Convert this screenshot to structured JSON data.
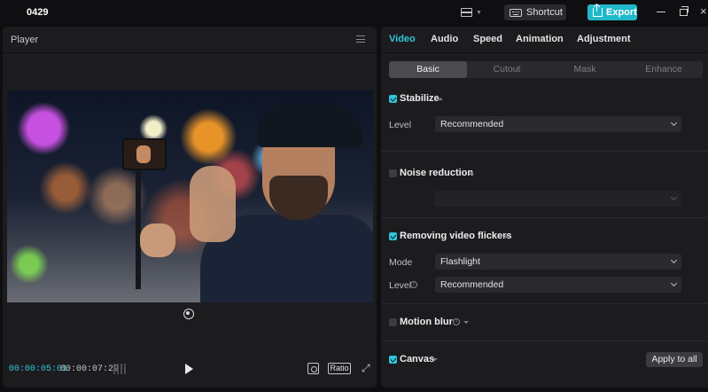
{
  "app": {
    "project_title": "0429"
  },
  "topbar": {
    "layout_icon": "layout-icon",
    "shortcut_label": "Shortcut",
    "export_label": "Export",
    "accent_color": "#21b8c9"
  },
  "player": {
    "title": "Player",
    "current_time": "00:00:05:01",
    "total_time": "00:00:07:29",
    "ratio_label": "Ratio"
  },
  "inspector": {
    "tabs": [
      {
        "label": "Video",
        "active": true
      },
      {
        "label": "Audio",
        "active": false
      },
      {
        "label": "Speed",
        "active": false
      },
      {
        "label": "Animation",
        "active": false
      },
      {
        "label": "Adjustment",
        "active": false
      }
    ],
    "subtabs": [
      {
        "label": "Basic",
        "active": true
      },
      {
        "label": "Cutout",
        "active": false
      },
      {
        "label": "Mask",
        "active": false
      },
      {
        "label": "Enhance",
        "active": false
      }
    ],
    "stabilize": {
      "title": "Stabilize",
      "checked": true,
      "level_label": "Level",
      "level_value": "Recommended"
    },
    "noise_reduction": {
      "title": "Noise reduction",
      "checked": false
    },
    "flickers": {
      "title": "Removing video flickers",
      "checked": true,
      "mode_label": "Mode",
      "mode_value": "Flashlight",
      "level_label": "Level",
      "level_value": "Recommended"
    },
    "motion_blur": {
      "title": "Motion blur",
      "checked": false
    },
    "canvas": {
      "title": "Canvas",
      "checked": true
    },
    "apply_all_label": "Apply to all"
  }
}
